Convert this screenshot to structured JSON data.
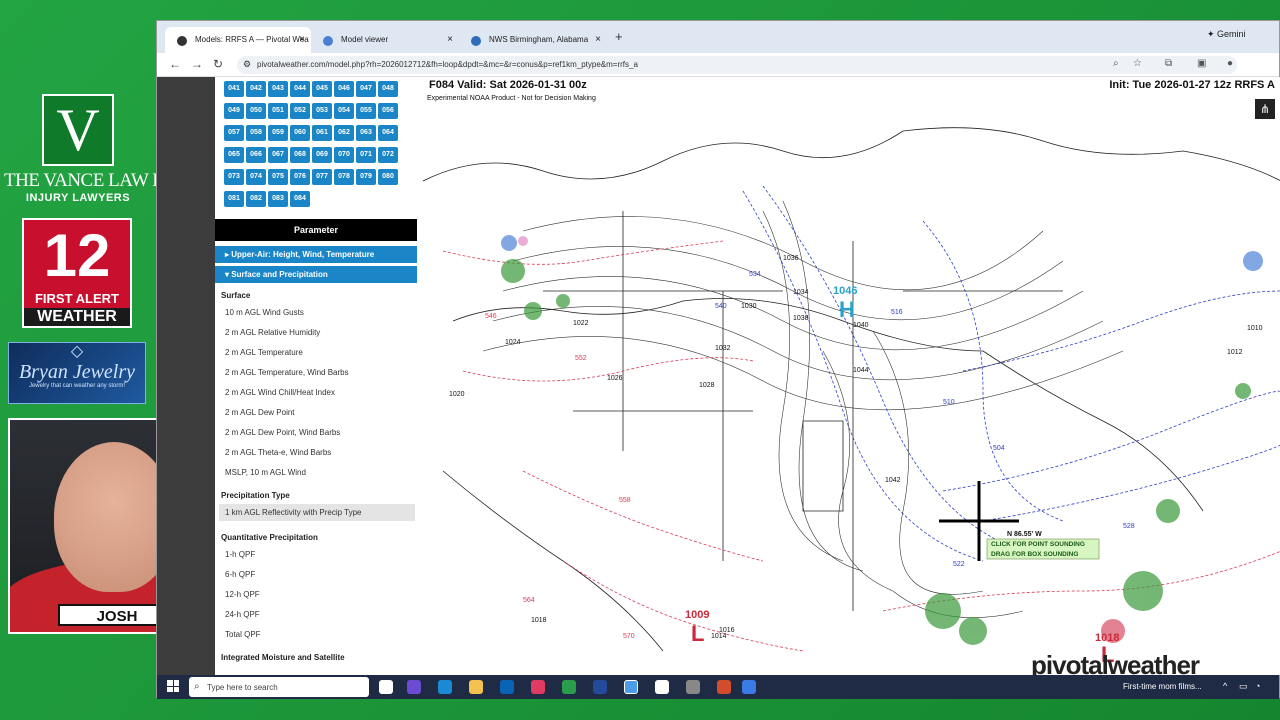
{
  "overlay": {
    "vance": {
      "letter": "V",
      "name": "THE VANCE LAW FIRM",
      "sub": "INJURY LAWYERS"
    },
    "station": {
      "num": "12",
      "line1": "FIRST ALERT",
      "line2": "WEATHER"
    },
    "bryan": {
      "name": "Bryan Jewelry",
      "tag": "Jewelry that can weather any storm!"
    },
    "presenter": "JOSH JOHNSON"
  },
  "tabs": [
    {
      "label": "Models: RRFS A — Pivotal Wea",
      "color": "#333"
    },
    {
      "label": "Model viewer",
      "color": "#4a7fd1"
    },
    {
      "label": "NWS Birmingham, Alabama",
      "color": "#2e6bb8"
    }
  ],
  "gemini": "Gemini",
  "url": "pivotalweather.com/model.php?rh=2026012712&fh=loop&dpdt=&mc=&r=conus&p=ref1km_ptype&m=rrfs_a",
  "hours": [
    "041",
    "042",
    "043",
    "044",
    "045",
    "046",
    "047",
    "048",
    "049",
    "050",
    "051",
    "052",
    "053",
    "054",
    "055",
    "056",
    "057",
    "058",
    "059",
    "060",
    "061",
    "062",
    "063",
    "064",
    "065",
    "066",
    "067",
    "068",
    "069",
    "070",
    "071",
    "072",
    "073",
    "074",
    "075",
    "076",
    "077",
    "078",
    "079",
    "080",
    "081",
    "082",
    "083",
    "084"
  ],
  "panel": {
    "param_heading": "Parameter",
    "cat_upper": "Upper-Air: Height, Wind, Temperature",
    "cat_surface": "Surface and Precipitation",
    "sub_surface": "Surface",
    "surface_items": [
      "10 m AGL Wind Gusts",
      "2 m AGL Relative Humidity",
      "2 m AGL Temperature",
      "2 m AGL Temperature, Wind Barbs",
      "2 m AGL Wind Chill/Heat Index",
      "2 m AGL Dew Point",
      "2 m AGL Dew Point, Wind Barbs",
      "2 m AGL Theta-e, Wind Barbs",
      "MSLP, 10 m AGL Wind"
    ],
    "sub_ptype": "Precipitation Type",
    "ptype_item": "1 km AGL Reflectivity with Precip Type",
    "sub_qpf": "Quantitative Precipitation",
    "qpf_items": [
      "1-h QPF",
      "6-h QPF",
      "12-h QPF",
      "24-h QPF",
      "Total QPF"
    ],
    "sub_moist": "Integrated Moisture and Satellite"
  },
  "map": {
    "valid": "F084 Valid: Sat 2026-01-31 00z",
    "init": "Init: Tue 2026-01-27 12z RRFS A",
    "disclaimer": "Experimental NOAA Product - Not for Decision Making",
    "high_value": "1046",
    "high_letter": "H",
    "low1_value": "1009",
    "low_letter": "L",
    "low2_value": "1018",
    "cursor_coords": "N 86.55' W",
    "click_hint": "CLICK FOR POINT SOUNDING",
    "drag_hint": "DRAG FOR BOX SOUNDING",
    "watermark": "pivotalweather",
    "pressure_labels": [
      {
        "t": "1036"
      },
      {
        "t": "1034"
      },
      {
        "t": "1030"
      },
      {
        "t": "1044"
      },
      {
        "t": "1038"
      },
      {
        "t": "1032"
      },
      {
        "t": "1028"
      },
      {
        "t": "1026"
      },
      {
        "t": "1024"
      },
      {
        "t": "1022"
      },
      {
        "t": "1020"
      },
      {
        "t": "1018"
      },
      {
        "t": "1040"
      },
      {
        "t": "1042"
      },
      {
        "t": "1016"
      },
      {
        "t": "1014"
      },
      {
        "t": "1010"
      },
      {
        "t": "1012"
      }
    ],
    "thickness_blue": [
      {
        "t": "534"
      },
      {
        "t": "540"
      },
      {
        "t": "516"
      },
      {
        "t": "510"
      },
      {
        "t": "504"
      },
      {
        "t": "522"
      },
      {
        "t": "528"
      }
    ],
    "thickness_red": [
      {
        "t": "546"
      },
      {
        "t": "552"
      },
      {
        "t": "558"
      },
      {
        "t": "564"
      },
      {
        "t": "570"
      }
    ]
  },
  "taskbar": {
    "search": "Type here to search",
    "notify": "First-time mom films..."
  }
}
